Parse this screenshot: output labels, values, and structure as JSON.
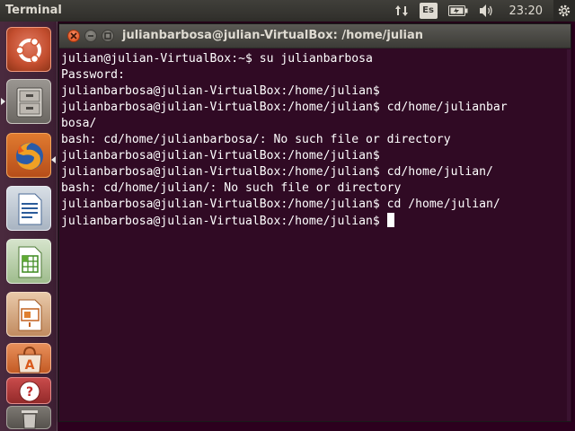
{
  "top_panel": {
    "app_title": "Terminal",
    "keyboard_layout": "Es",
    "clock": "23:20",
    "icons": [
      "network-updown-icon",
      "keyboard-layout-icon",
      "battery-icon",
      "volume-icon",
      "session-gear-icon"
    ]
  },
  "launcher": {
    "items": [
      {
        "name": "dash-home",
        "icon": "ubuntu-logo-icon"
      },
      {
        "name": "files",
        "icon": "file-cabinet-icon"
      },
      {
        "name": "firefox",
        "icon": "firefox-icon"
      },
      {
        "name": "libreoffice-writer",
        "icon": "writer-document-icon"
      },
      {
        "name": "libreoffice-calc",
        "icon": "calc-spreadsheet-icon"
      },
      {
        "name": "libreoffice-impress",
        "icon": "impress-presentation-icon"
      },
      {
        "name": "ubuntu-software-center",
        "icon": "shopping-bag-icon"
      },
      {
        "name": "help",
        "icon": "help-icon"
      },
      {
        "name": "trash",
        "icon": "trash-icon"
      }
    ]
  },
  "window": {
    "title": "julianbarbosa@julian-VirtualBox: /home/julian",
    "close_label": "×",
    "minimize_label": "–",
    "maximize_label": "□"
  },
  "terminal": {
    "lines": [
      "julian@julian-VirtualBox:~$ su julianbarbosa",
      "Password: ",
      "julianbarbosa@julian-VirtualBox:/home/julian$ ",
      "julianbarbosa@julian-VirtualBox:/home/julian$ cd/home/julianbar",
      "bosa/",
      "bash: cd/home/julianbarbosa/: No such file or directory",
      "julianbarbosa@julian-VirtualBox:/home/julian$ ",
      "julianbarbosa@julian-VirtualBox:/home/julian$ cd/home/julian/",
      "bash: cd/home/julian/: No such file or directory",
      "julianbarbosa@julian-VirtualBox:/home/julian$ cd /home/julian/"
    ],
    "current_prompt": "julianbarbosa@julian-VirtualBox:/home/julian$ ",
    "colors": {
      "background": "#300a24",
      "foreground": "#ffffff"
    }
  }
}
